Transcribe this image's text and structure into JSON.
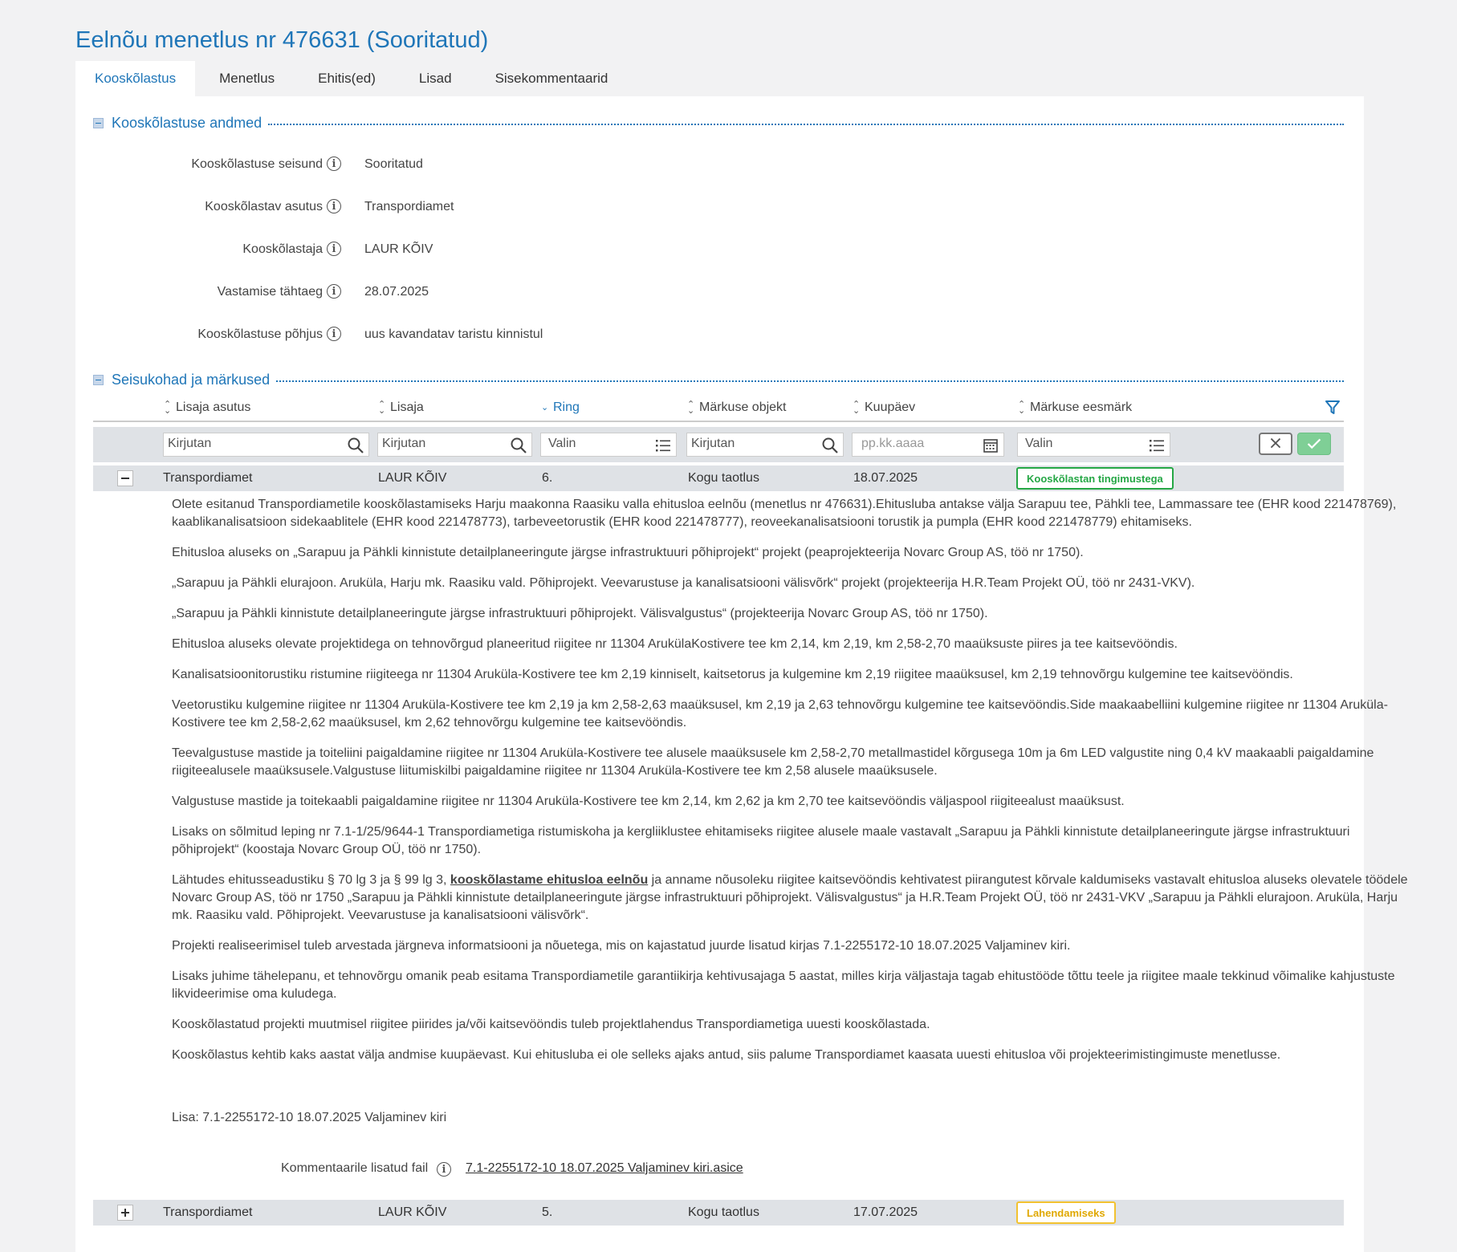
{
  "page_title": "Eelnõu menetlus nr 476631 (Sooritatud)",
  "tabs": [
    {
      "label": "Kooskõlastus"
    },
    {
      "label": "Menetlus"
    },
    {
      "label": "Ehitis(ed)"
    },
    {
      "label": "Lisad"
    },
    {
      "label": "Sisekommentaarid"
    }
  ],
  "section1": {
    "title": "Kooskõlastuse andmed",
    "fields": [
      {
        "label": "Kooskõlastuse seisund",
        "value": "Sooritatud"
      },
      {
        "label": "Kooskõlastav asutus",
        "value": "Transpordiamet"
      },
      {
        "label": "Kooskõlastaja",
        "value": "LAUR KÕIV"
      },
      {
        "label": "Vastamise tähtaeg",
        "value": "28.07.2025"
      },
      {
        "label": "Kooskõlastuse põhjus",
        "value": "uus kavandatav taristu kinnistul"
      }
    ]
  },
  "section2": {
    "title": "Seisukohad ja märkused",
    "columns": [
      "Lisaja asutus",
      "Lisaja",
      "Ring",
      "Märkuse objekt",
      "Kuupäev",
      "Märkuse eesmärk"
    ],
    "filters": {
      "asutus": "Kirjutan",
      "lisaja": "Kirjutan",
      "ring": "Valin",
      "objekt": "Kirjutan",
      "kuupaev": "pp.kk.aaaa",
      "eesmark": "Valin"
    }
  },
  "rows": [
    {
      "asutus": "Transpordiamet",
      "lisaja": "LAUR KÕIV",
      "ring": "6.",
      "objekt": "Kogu taotlus",
      "kuupaev": "18.07.2025",
      "eesmark": "Kooskõlastan tingimustega"
    },
    {
      "asutus": "Transpordiamet",
      "lisaja": "LAUR KÕIV",
      "ring": "5.",
      "objekt": "Kogu taotlus",
      "kuupaev": "17.07.2025",
      "eesmark": "Lahendamiseks"
    }
  ],
  "comment": {
    "p1": "Olete esitanud Transpordiametile kooskõlastamiseks Harju maakonna Raasiku valla ehitusloa eelnõu (menetlus nr 476631).Ehitusluba antakse välja Sarapuu tee, Pähkli tee, Lammassare tee (EHR kood 221478769), kaablikanalisatsioon sidekaablitele (EHR kood 221478773), tarbeveetorustik (EHR kood 221478777), reoveekanalisatsiooni torustik ja pumpla (EHR kood 221478779) ehitamiseks.",
    "p2": "Ehitusloa aluseks on „Sarapuu ja Pähkli kinnistute detailplaneeringute järgse infrastruktuuri põhiprojekt“ projekt (peaprojekteerija Novarc Group AS, töö nr 1750).",
    "p3": "„Sarapuu ja Pähkli elurajoon. Aruküla, Harju mk. Raasiku vald. Põhiprojekt. Veevarustuse ja kanalisatsiooni välisvõrk“ projekt (projekteerija H.R.Team Projekt OÜ, töö nr 2431-VKV).",
    "p4": "„Sarapuu ja Pähkli kinnistute detailplaneeringute järgse infrastruktuuri põhiprojekt. Välisvalgustus“ (projekteerija Novarc Group AS, töö nr 1750).",
    "p5": "Ehitusloa aluseks olevate projektidega on tehnovõrgud planeeritud riigitee nr 11304 ArukülaKostivere tee km 2,14, km 2,19, km 2,58-2,70 maaüksuste piires ja tee kaitsevööndis.",
    "p6": "Kanalisatsioonitorustiku ristumine riigiteega nr 11304 Aruküla-Kostivere tee km 2,19 kinniselt, kaitsetorus ja kulgemine km 2,19 riigitee maaüksusel, km 2,19 tehnovõrgu kulgemine tee kaitsevööndis.",
    "p7": "Veetorustiku kulgemine riigitee nr 11304 Aruküla-Kostivere tee km 2,19 ja km 2,58-2,63 maaüksusel, km 2,19 ja 2,63 tehnovõrgu kulgemine tee kaitsevööndis.Side maakaabelliini kulgemine riigitee nr 11304 Aruküla-Kostivere tee km 2,58-2,62 maaüksusel, km 2,62 tehnovõrgu kulgemine tee kaitsevööndis.",
    "p8": "Teevalgustuse mastide ja toiteliini paigaldamine riigitee nr 11304 Aruküla-Kostivere tee alusele maaüksusele km 2,58-2,70 metallmastidel kõrgusega 10m ja 6m LED valgustite ning 0,4 kV maakaabli paigaldamine riigiteealusele maaüksusele.Valgustuse liitumiskilbi paigaldamine riigitee nr 11304 Aruküla-Kostivere tee km 2,58 alusele maaüksusele.",
    "p9": "Valgustuse mastide ja toitekaabli paigaldamine riigitee nr 11304 Aruküla-Kostivere tee km 2,14, km 2,62 ja km 2,70 tee kaitsevööndis väljaspool riigiteealust maaüksust.",
    "p10": "Lisaks on sõlmitud leping nr 7.1-1/25/9644-1 Transpordiametiga ristumiskoha ja kergliiklustee ehitamiseks riigitee alusele maale vastavalt „Sarapuu ja Pähkli kinnistute detailplaneeringute järgse infrastruktuuri põhiprojekt“ (koostaja Novarc Group OÜ, töö nr 1750).",
    "p11_a": "Lähtudes ehitusseadustiku § 70 lg 3 ja § 99 lg 3, ",
    "p11_b": "kooskõlastame ehitusloa eelnõu",
    "p11_c": " ja anname nõusoleku riigitee kaitsevööndis kehtivatest piirangutest kõrvale kaldumiseks vastavalt ehitusloa aluseks olevatele töödele Novarc Group AS, töö nr 1750 „Sarapuu ja Pähkli kinnistute detailplaneeringute järgse infrastruktuuri põhiprojekt. Välisvalgustus“ ja H.R.Team Projekt OÜ, töö nr 2431-VKV „Sarapuu ja Pähkli elurajoon. Aruküla, Harju mk. Raasiku vald. Põhiprojekt. Veevarustuse ja kanalisatsiooni välisvõrk“.",
    "p12": "Projekti realiseerimisel tuleb arvestada järgneva informatsiooni ja nõuetega, mis on kajastatud juurde lisatud kirjas 7.1-2255172-10 18.07.2025 Valjaminev kiri.",
    "p13": "Lisaks juhime tähelepanu, et tehnovõrgu omanik peab esitama Transpordiametile garantiikirja kehtivusajaga 5 aastat, milles kirja väljastaja tagab ehitustööde tõttu teele ja riigitee maale tekkinud võimalike kahjustuste likvideerimise oma kuludega.",
    "p14": "Kooskõlastatud projekti muutmisel riigitee piirides ja/või kaitsevööndis tuleb projektlahendus Transpordiametiga uuesti kooskõlastada.",
    "p15": "Kooskõlastus kehtib kaks aastat välja andmise kuupäevast. Kui ehitusluba ei ole selleks ajaks antud, siis palume Transpordiamet kaasata uuesti ehitusloa või projekteerimistingimuste menetlusse.",
    "attachment_note": "Lisa: 7.1-2255172-10 18.07.2025 Valjaminev kiri"
  },
  "attached_file": {
    "label": "Kommentaarile lisatud fail",
    "link": "7.1-2255172-10 18.07.2025 Valjaminev kiri.asice"
  },
  "colors": {
    "accent": "#1f76b8",
    "badge_green": "#25a745",
    "badge_yellow": "#f2c230"
  },
  "icons": [
    "info-icon",
    "search-icon",
    "list-icon",
    "calendar-icon",
    "filter-icon",
    "close-icon",
    "check-icon",
    "collapse-icon",
    "expand-icon"
  ]
}
